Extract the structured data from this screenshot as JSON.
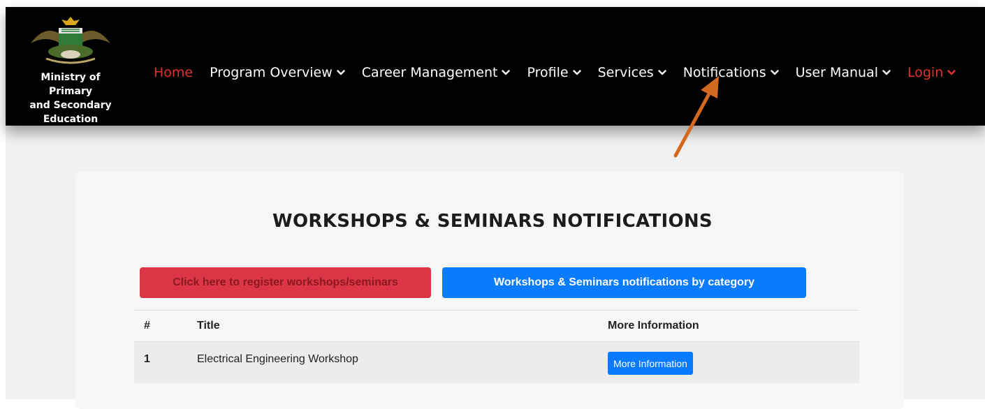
{
  "brand": {
    "line1": "Ministry of Primary",
    "line2": "and Secondary",
    "line3": "Education"
  },
  "nav": {
    "items": [
      {
        "label": "Home",
        "dropdown": false,
        "color": "#e0312f"
      },
      {
        "label": "Program Overview",
        "dropdown": true
      },
      {
        "label": "Career Management",
        "dropdown": true
      },
      {
        "label": "Profile",
        "dropdown": true
      },
      {
        "label": "Services",
        "dropdown": true
      },
      {
        "label": "Notifications",
        "dropdown": true
      },
      {
        "label": "User Manual",
        "dropdown": true
      },
      {
        "label": "Login",
        "dropdown": true,
        "color": "#e0312f"
      }
    ]
  },
  "main": {
    "title": "WORKSHOPS & SEMINARS NOTIFICATIONS",
    "register_button": "Click here to register workshops/seminars",
    "category_button": "Workshops & Seminars notifications by category",
    "table": {
      "headers": [
        "#",
        "Title",
        "More Information"
      ],
      "rows": [
        {
          "num": "1",
          "title": "Electrical Engineering Workshop",
          "action": "More Information"
        }
      ]
    }
  },
  "colors": {
    "navbar_bg": "#000000",
    "accent_red": "#dc3545",
    "accent_blue": "#0a7bff",
    "annotation_arrow": "#d2691e"
  }
}
